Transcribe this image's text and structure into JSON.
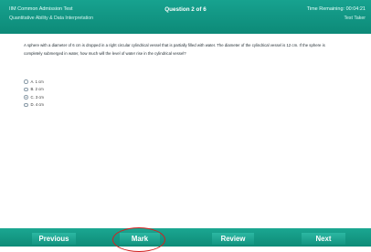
{
  "header": {
    "test_name": "IIM Common Admission Test",
    "section": "Quantitative Ability & Data Interpretation",
    "question_label": "Question 2 of 6",
    "timer_label": "Time Remaining: 00:04:21",
    "role": "Test Taker"
  },
  "question": {
    "text": "A sphere with a diameter of 6 cm is dropped in a right circular cylindrical vessel that is partially filled with water. The diameter of the cylindrical vessel is 12 cm. If the sphere is completely submerged in water, how much will the level of water rise in the cylindrical vessel?",
    "options": [
      {
        "label": "A. 1 cm",
        "selected": false
      },
      {
        "label": "B. 2 cm",
        "selected": false
      },
      {
        "label": "C. 3 cm",
        "selected": true
      },
      {
        "label": "D. 4 cm",
        "selected": false
      }
    ]
  },
  "footer": {
    "previous_label": "Previous",
    "mark_label": "Mark",
    "review_label": "Review",
    "next_label": "Next"
  },
  "colors": {
    "header_bar": "#12957f",
    "button": "#1ea38e",
    "annotation_circle": "#d41f1f"
  }
}
